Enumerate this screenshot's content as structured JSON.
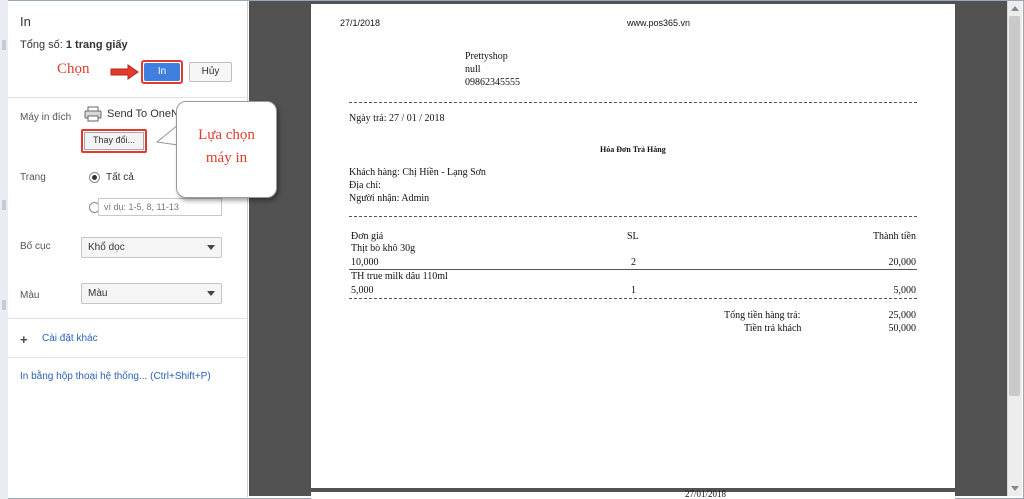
{
  "dialog": {
    "title": "In",
    "total_label": "Tổng số:",
    "total_value": "1 trang giấy",
    "print_button": "In",
    "cancel_button": "Hủy"
  },
  "settings": {
    "destination_label": "Máy in đích",
    "printer_name": "Send To OneNote",
    "change_button": "Thay đổi...",
    "pages_label": "Trang",
    "pages_all": "Tất cả",
    "pages_custom_placeholder": "ví dụ: 1-5, 8, 11-13",
    "layout_label": "Bố cục",
    "layout_value": "Khổ dọc",
    "color_label": "Màu",
    "color_value": "Màu",
    "more_settings": "Cài đặt khác",
    "system_dialog_link": "In bằng hộp thoại hệ thống... (Ctrl+Shift+P)"
  },
  "annotations": {
    "choose_label": "Chọn",
    "select_printer_line1": "Lựa chọn",
    "select_printer_line2": "máy in",
    "accent_color": "#e23b2e"
  },
  "receipt": {
    "header_date": "27/1/2018",
    "header_site": "www.pos365.vn",
    "shop_name": "Prettyshop",
    "shop_line2": "null",
    "shop_phone": "09862345555",
    "return_date": "Ngày trả: 27 / 01 / 2018",
    "doc_title": "Hóa Đơn Trả Hàng",
    "customer": "Khách hàng: Chị Hiền - Lạng Sơn",
    "address": "Địa chỉ:",
    "receiver": "Người nhận: Admin",
    "columns": {
      "price": "Đơn giá",
      "qty": "SL",
      "total": "Thành tiền"
    },
    "items": [
      {
        "name": "Thịt bò khô 30g",
        "price": "10,000",
        "qty": "2",
        "total": "20,000"
      },
      {
        "name": "TH true milk dâu 110ml",
        "price": "5,000",
        "qty": "1",
        "total": "5,000"
      }
    ],
    "sum_label": "Tổng tiền hàng trả:",
    "sum_value": "25,000",
    "paid_label": "Tiền trả khách",
    "paid_value": "50,000",
    "next_page_date": "27/01/2018"
  }
}
